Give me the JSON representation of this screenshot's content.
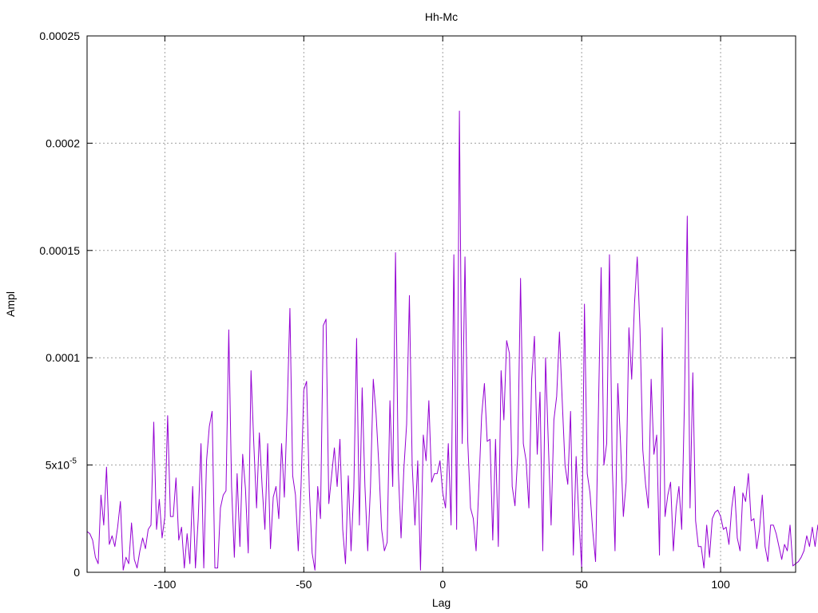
{
  "chart_data": {
    "type": "line",
    "title": "Hh-Mc",
    "xlabel": "Lag",
    "ylabel": "Ampl",
    "xlim": [
      -128,
      127
    ],
    "ylim": [
      0,
      0.00025
    ],
    "grid": true,
    "x_ticks": [
      {
        "value": -100,
        "label": "-100"
      },
      {
        "value": -50,
        "label": "-50"
      },
      {
        "value": 0,
        "label": "0"
      },
      {
        "value": 50,
        "label": "50"
      },
      {
        "value": 100,
        "label": "100"
      }
    ],
    "y_ticks": [
      {
        "value": 0,
        "label": "0"
      },
      {
        "value": 5e-05,
        "label": "5x10",
        "sup": "-5"
      },
      {
        "value": 0.0001,
        "label": "0.0001"
      },
      {
        "value": 0.00015,
        "label": "0.00015"
      },
      {
        "value": 0.0002,
        "label": "0.0002"
      },
      {
        "value": 0.00025,
        "label": "0.00025"
      }
    ],
    "series": [
      {
        "color": "#9400d3",
        "x_start": -128,
        "x_step": 1,
        "values": [
          1.9e-05,
          1.8e-05,
          1.5e-05,
          7e-06,
          4e-06,
          3.6e-05,
          2.2e-05,
          4.9e-05,
          1.3e-05,
          1.7e-05,
          1.2e-05,
          2.1e-05,
          3.3e-05,
          1e-06,
          7e-06,
          4e-06,
          2.3e-05,
          6e-06,
          2e-06,
          1e-05,
          1.6e-05,
          1.1e-05,
          2e-05,
          2.2e-05,
          7e-05,
          2e-05,
          3.4e-05,
          1.6e-05,
          2.6e-05,
          7.3e-05,
          2.6e-05,
          2.6e-05,
          4.4e-05,
          1.5e-05,
          2.1e-05,
          2e-06,
          1.8e-05,
          4e-06,
          4e-05,
          2e-06,
          2.5e-05,
          6e-05,
          2e-06,
          5.2e-05,
          6.8e-05,
          7.5e-05,
          2e-06,
          2e-06,
          3e-05,
          3.6e-05,
          3.8e-05,
          0.000113,
          4e-05,
          7e-06,
          4.6e-05,
          1.2e-05,
          5.5e-05,
          3.9e-05,
          9e-06,
          9.4e-05,
          6e-05,
          3e-05,
          6.5e-05,
          4e-05,
          2e-05,
          6e-05,
          1.1e-05,
          3.5e-05,
          4e-05,
          2.5e-05,
          6e-05,
          3.5e-05,
          7.5e-05,
          0.000123,
          4.5e-05,
          3.6e-05,
          1e-05,
          4e-05,
          8.5e-05,
          8.9e-05,
          3.8e-05,
          9e-06,
          1e-06,
          4e-05,
          2.5e-05,
          0.000115,
          0.000118,
          3.2e-05,
          4.5e-05,
          5.8e-05,
          4e-05,
          6.2e-05,
          2e-05,
          4e-06,
          4.5e-05,
          1e-05,
          3.9e-05,
          0.000109,
          2.2e-05,
          8.6e-05,
          4e-05,
          1e-05,
          4e-05,
          9e-05,
          7.4e-05,
          5e-05,
          2e-05,
          1e-05,
          1.4e-05,
          8e-05,
          4e-05,
          0.000149,
          4.8e-05,
          1.6e-05,
          4.8e-05,
          6.9e-05,
          0.000129,
          5e-05,
          2.2e-05,
          5.2e-05,
          1e-06,
          6.4e-05,
          5.2e-05,
          8e-05,
          4.2e-05,
          4.6e-05,
          4.6e-05,
          5.2e-05,
          3.7e-05,
          3e-05,
          6e-05,
          2.2e-05,
          0.000148,
          2e-05,
          0.000215,
          6e-05,
          0.000147,
          6.1e-05,
          3e-05,
          2.5e-05,
          1e-05,
          4e-05,
          7.3e-05,
          8.8e-05,
          6.1e-05,
          6.2e-05,
          1.5e-05,
          6.2e-05,
          1.2e-05,
          9.4e-05,
          7.1e-05,
          0.000108,
          0.000102,
          4e-05,
          3.1e-05,
          5.5e-05,
          0.000137,
          6e-05,
          5.2e-05,
          3e-05,
          9e-05,
          0.00011,
          5.5e-05,
          8.4e-05,
          1e-05,
          0.0001,
          6e-05,
          2.2e-05,
          7.1e-05,
          8.2e-05,
          0.000112,
          8e-05,
          5e-05,
          4.1e-05,
          7.5e-05,
          8e-06,
          5.4e-05,
          2.5e-05,
          2e-06,
          0.000125,
          4.6e-05,
          3.7e-05,
          1.9e-05,
          5e-06,
          7.3e-05,
          0.000142,
          5e-05,
          6e-05,
          0.000148,
          5e-05,
          1e-05,
          8.8e-05,
          6e-05,
          2.6e-05,
          4.2e-05,
          0.000114,
          9e-05,
          0.000125,
          0.000147,
          0.000113,
          5.7e-05,
          4.1e-05,
          3e-05,
          9e-05,
          5.5e-05,
          6.4e-05,
          8e-06,
          0.000114,
          2.6e-05,
          3.6e-05,
          4.2e-05,
          1e-05,
          3e-05,
          4e-05,
          2e-05,
          8e-05,
          0.000166,
          3e-05,
          9.3e-05,
          2.4e-05,
          1.2e-05,
          1.2e-05,
          2e-06,
          2.2e-05,
          7e-06,
          2.5e-05,
          2.8e-05,
          2.9e-05,
          2.6e-05,
          2e-05,
          2.1e-05,
          1.3e-05,
          3e-05,
          4e-05,
          1.6e-05,
          1e-05,
          3.7e-05,
          3.3e-05,
          4.6e-05,
          2.4e-05,
          2.5e-05,
          1.1e-05,
          2e-05,
          3.6e-05,
          1.2e-05,
          5e-06,
          2.2e-05,
          2.2e-05,
          1.8e-05,
          1.2e-05,
          6e-06,
          1.3e-05,
          1e-05,
          2.2e-05,
          3e-06,
          4e-06,
          5e-06,
          7e-06,
          1e-05,
          1.7e-05,
          1.2e-05,
          2.1e-05,
          1.2e-05,
          2.2e-05,
          8e-06
        ]
      }
    ]
  }
}
